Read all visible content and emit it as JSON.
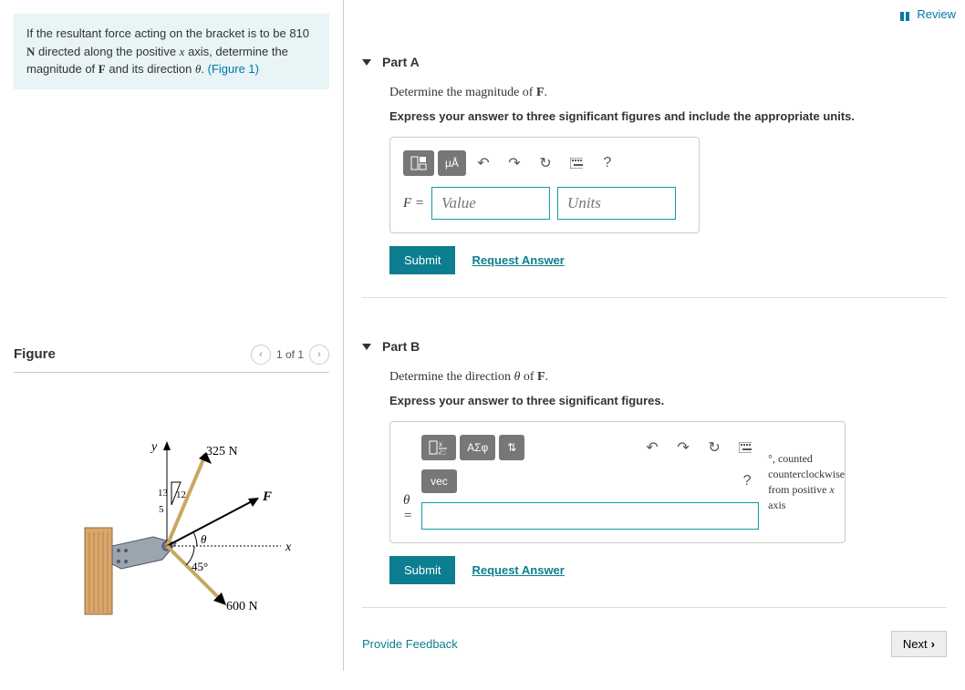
{
  "review": "Review",
  "problem": {
    "text1": "If the resultant force acting on the bracket is to be 810 ",
    "unit": "N",
    "text2": " directed along the positive ",
    "var_x": "x",
    "text3": " axis, determine the magnitude of ",
    "F": "F",
    "text4": " and its direction ",
    "theta": "θ",
    "text5": ". ",
    "figlink": "(Figure 1)"
  },
  "figure": {
    "title": "Figure",
    "nav": "1 of 1"
  },
  "partA": {
    "title": "Part A",
    "prompt1": "Determine the magnitude of ",
    "promptF": "F",
    "prompt2": ".",
    "instr": "Express your answer to three significant figures and include the appropriate units.",
    "eq": "F =",
    "value_ph": "Value",
    "units_ph": "Units",
    "submit": "Submit",
    "request": "Request Answer",
    "btn_uA": "µÅ"
  },
  "partB": {
    "title": "Part B",
    "prompt1": "Determine the direction ",
    "theta": "θ",
    "prompt2": " of ",
    "F": "F",
    "prompt3": ".",
    "instr": "Express your answer to three significant figures.",
    "eq": "θ =",
    "hint": ", counted counterclockwise from positive ",
    "hint_deg": "°",
    "hint_x": "x",
    "hint2": " axis",
    "submit": "Submit",
    "request": "Request Answer",
    "vec": "vec",
    "asphi": "ΑΣφ"
  },
  "footer": {
    "feedback": "Provide Feedback",
    "next": "Next"
  },
  "diagram": {
    "f1": "325 N",
    "f2": "600 N",
    "F": "F",
    "ang45": "45°",
    "theta": "θ",
    "x": "x",
    "y": "y",
    "tri13": "13",
    "tri12": "12",
    "tri5": "5"
  }
}
